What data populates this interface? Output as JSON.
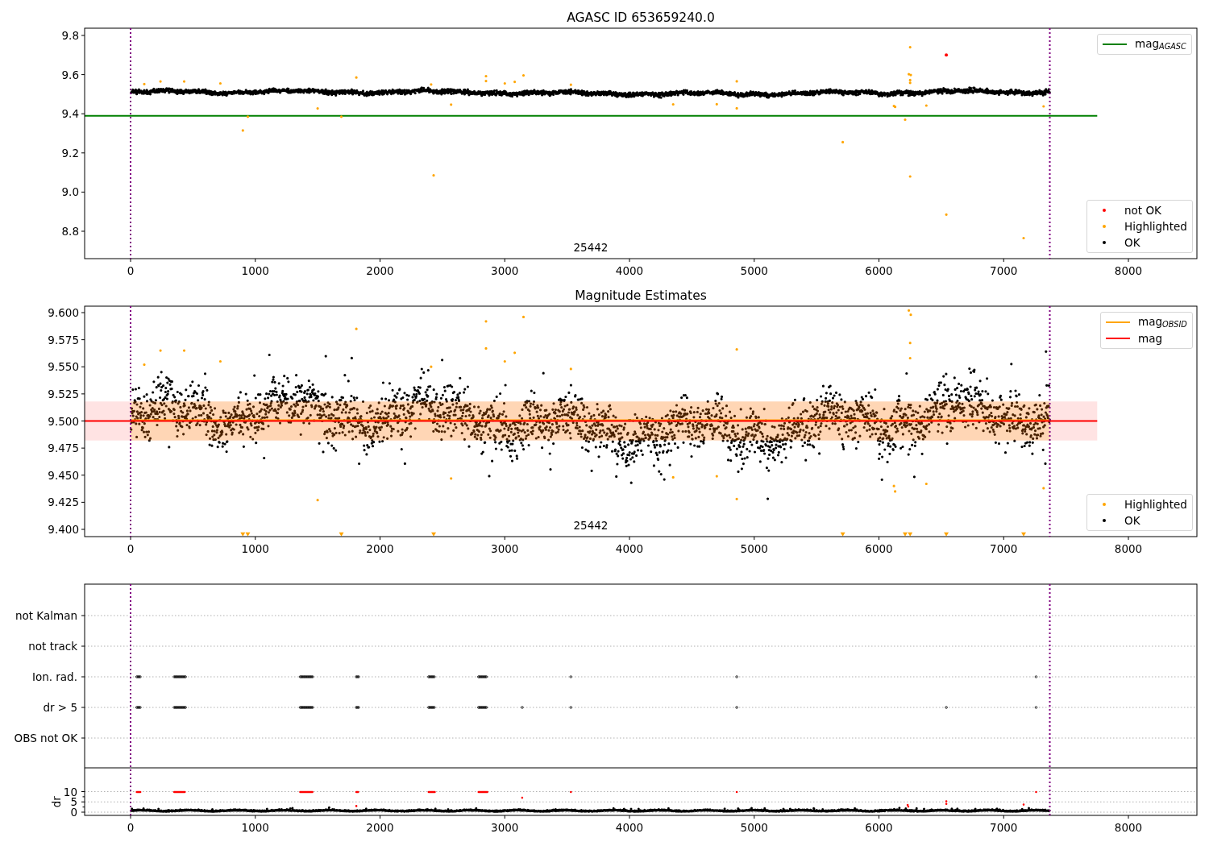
{
  "figure": {
    "panels": [
      {
        "kind": "agasc",
        "title": "AGASC ID 653659240.0",
        "annotation": "25442",
        "xticks": [
          "0",
          "1000",
          "2000",
          "3000",
          "4000",
          "5000",
          "6000",
          "7000",
          "8000"
        ],
        "yticks": [
          "9.8",
          "9.6",
          "9.4",
          "9.2",
          "9.0",
          "8.8"
        ],
        "legends": [
          [
            {
              "kind": "line",
              "label": "mag$_{AGASC}$",
              "color": "#008000"
            }
          ],
          [
            {
              "kind": "dot",
              "label": "not OK",
              "color": "#ff0000"
            },
            {
              "kind": "dot",
              "label": "Highlighted",
              "color": "#ffa500"
            },
            {
              "kind": "dot",
              "label": "OK",
              "color": "#000000"
            }
          ]
        ]
      },
      {
        "kind": "estimates",
        "title": "Magnitude Estimates",
        "annotation": "25442",
        "xticks": [
          "0",
          "1000",
          "2000",
          "3000",
          "4000",
          "5000",
          "6000",
          "7000",
          "8000"
        ],
        "yticks": [
          "9.600",
          "9.575",
          "9.550",
          "9.525",
          "9.500",
          "9.475",
          "9.450",
          "9.425",
          "9.400"
        ],
        "legends": [
          [
            {
              "kind": "line",
              "label": "mag$_{OBSID}$",
              "color": "#ffa500"
            },
            {
              "kind": "line",
              "label": "mag",
              "color": "#ff0000"
            }
          ],
          [
            {
              "kind": "dot",
              "label": "Highlighted",
              "color": "#ffa500"
            },
            {
              "kind": "dot",
              "label": "OK",
              "color": "#000000"
            }
          ]
        ]
      },
      {
        "kind": "flags",
        "categories": [
          "not Kalman",
          "not track",
          "Ion. rad.",
          "dr > 5",
          "OBS not OK"
        ],
        "ylabel": "dr",
        "yticks": [
          "10",
          "5",
          "0"
        ],
        "xticks": [
          "0",
          "1000",
          "2000",
          "3000",
          "4000",
          "5000",
          "6000",
          "7000",
          "8000"
        ]
      }
    ]
  }
}
